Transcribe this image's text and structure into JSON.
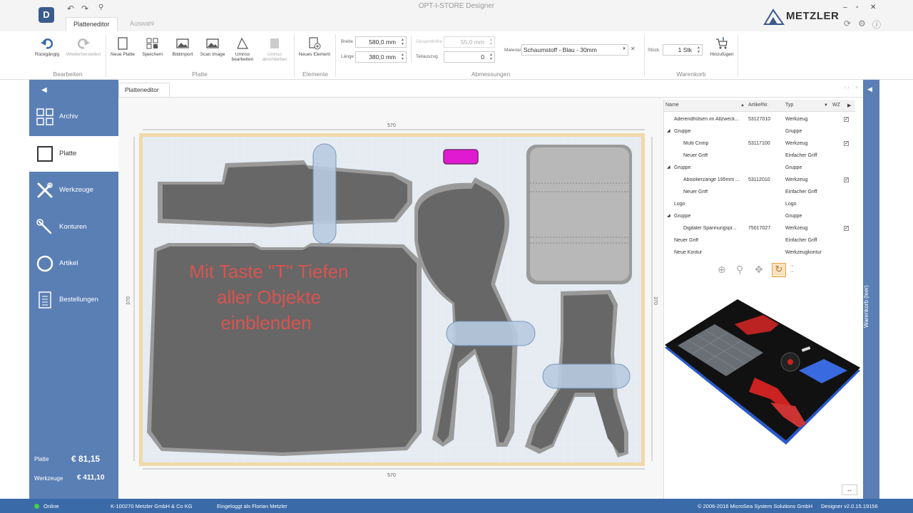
{
  "app": {
    "title": "OPT-I-STORE Designer",
    "logo_letter": "D",
    "brand": "METZLER",
    "tabs": [
      "Platteneditor",
      "Auswahl"
    ]
  },
  "ribbon": {
    "bearbeiten": {
      "label": "Bearbeiten",
      "undo": "Rückgängig",
      "redo": "Wiederherstellen"
    },
    "platte": {
      "label": "Platte",
      "new": "Neue Platte",
      "save": "Speichern",
      "import": "Bildimport",
      "scan": "Scan Image",
      "outline_edit": "Umriss bearbeiten",
      "outline_close": "Umriss abschließen"
    },
    "elemente": {
      "label": "Elemente",
      "new_element": "Neues Element"
    },
    "abmessungen": {
      "label": "Abmessungen",
      "breite_label": "Breite",
      "breite": "580,0 mm",
      "laenge_label": "Länge",
      "laenge": "380,0 mm",
      "gesamthoehe_label": "Gesamthöhe",
      "gesamthoehe": "55,0 mm",
      "teilauszug_label": "Teilauszug",
      "teilauszug": "0",
      "material_label": "Material",
      "material": "Schaumstoff - Blau - 30mm"
    },
    "warenkorb": {
      "label": "Warenkorb",
      "stueck_label": "Stück",
      "stueck": "1 Stk",
      "add": "Hinzufügen"
    }
  },
  "sidebar": {
    "items": [
      {
        "label": "Archiv",
        "icon": "grid-icon"
      },
      {
        "label": "Platte",
        "icon": "square-icon"
      },
      {
        "label": "Werkzeuge",
        "icon": "tools-icon"
      },
      {
        "label": "Konturen",
        "icon": "wrench-icon"
      },
      {
        "label": "Artikel",
        "icon": "circle-icon"
      },
      {
        "label": "Bestellungen",
        "icon": "document-icon"
      }
    ],
    "platte_label": "Platte",
    "platte_price": "€ 81,15",
    "werkzeuge_label": "Werkzeuge",
    "werkzeuge_price": "€ 411,10"
  },
  "editor": {
    "tab": "Platteneditor",
    "dim_top": "570",
    "dim_bottom": "570",
    "dim_left": "370",
    "dim_right": "370",
    "overlay_text": [
      "Mit Taste \"T\" Tiefen",
      "aller Objekte",
      "einblenden"
    ]
  },
  "tree": {
    "headers": {
      "name": "Name",
      "artnr": "ArtikelNr.",
      "typ": "Typ",
      "wz": "WZ"
    },
    "rows": [
      {
        "name": "Aderendhülsen im Allzweck...",
        "artnr": "53127010",
        "typ": "Werkzeug",
        "checked": true,
        "indent": 1,
        "group": false
      },
      {
        "name": "Gruppe",
        "artnr": "",
        "typ": "Gruppe",
        "checked": false,
        "indent": 1,
        "group": true
      },
      {
        "name": "Multi Crimp",
        "artnr": "53117100",
        "typ": "Werkzeug",
        "checked": true,
        "indent": 2,
        "group": false
      },
      {
        "name": "Neuer Griff",
        "artnr": "",
        "typ": "Einfacher Griff",
        "checked": false,
        "indent": 2,
        "group": false
      },
      {
        "name": "Gruppe",
        "artnr": "",
        "typ": "Gruppe",
        "checked": false,
        "indent": 1,
        "group": true
      },
      {
        "name": "Abisolierzange 195mm ...",
        "artnr": "53112010",
        "typ": "Werkzeug",
        "checked": true,
        "indent": 2,
        "group": false
      },
      {
        "name": "Neuer Griff",
        "artnr": "",
        "typ": "Einfacher Griff",
        "checked": false,
        "indent": 2,
        "group": false
      },
      {
        "name": "Logo",
        "artnr": "",
        "typ": "Logo",
        "checked": false,
        "indent": 1,
        "group": false
      },
      {
        "name": "Gruppe",
        "artnr": "",
        "typ": "Gruppe",
        "checked": false,
        "indent": 1,
        "group": true
      },
      {
        "name": "Digitaler Spannungspr...",
        "artnr": "75017027",
        "typ": "Werkzeug",
        "checked": true,
        "indent": 2,
        "group": false
      },
      {
        "name": "Neuer Griff",
        "artnr": "",
        "typ": "Einfacher Griff",
        "checked": false,
        "indent": 1,
        "group": false
      },
      {
        "name": "Neue Kontur",
        "artnr": "",
        "typ": "Werkzeugkontur",
        "checked": false,
        "indent": 1,
        "group": false
      }
    ]
  },
  "status": {
    "online": "Online",
    "customer": "K-100270 Metzler GmbH & Co KG",
    "user": "Eingeloggt als Florian Metzler",
    "copyright": "© 2006-2016 MicroSea System Solutions GmbH",
    "version": "Designer v2.0.15.19156"
  },
  "colors": {
    "accent": "#5a7fb5",
    "statusbar": "#3b6aa8",
    "overlay_text": "#d9534f",
    "magenta": "#e01ad0"
  }
}
